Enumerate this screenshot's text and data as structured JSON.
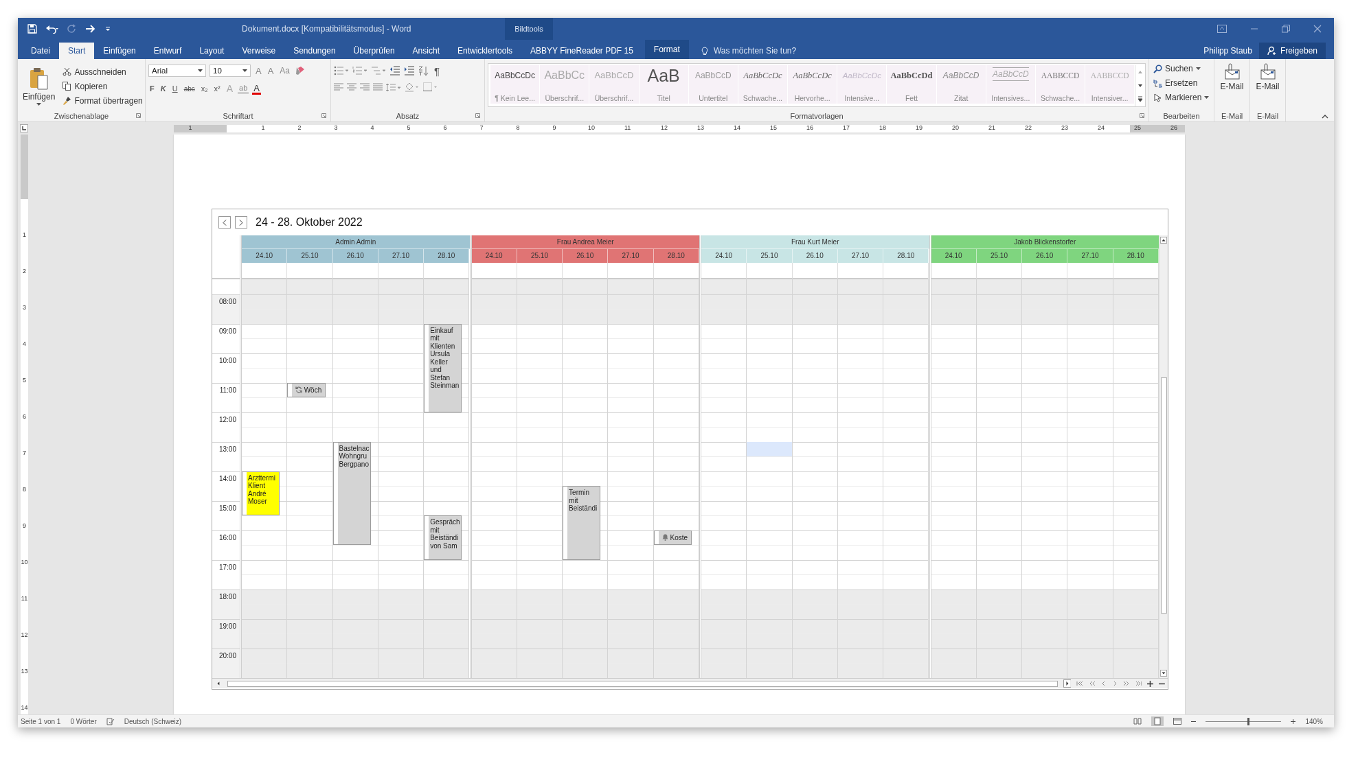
{
  "window": {
    "title": "Dokument.docx [Kompatibilitätsmodus] - Word",
    "context_label": "Bildtools"
  },
  "tabs": [
    {
      "label": "Datei",
      "selected": false,
      "kind": "normal"
    },
    {
      "label": "Start",
      "selected": true,
      "kind": "normal"
    },
    {
      "label": "Einfügen",
      "selected": false,
      "kind": "normal"
    },
    {
      "label": "Entwurf",
      "selected": false,
      "kind": "normal"
    },
    {
      "label": "Layout",
      "selected": false,
      "kind": "normal"
    },
    {
      "label": "Verweise",
      "selected": false,
      "kind": "normal"
    },
    {
      "label": "Sendungen",
      "selected": false,
      "kind": "normal"
    },
    {
      "label": "Überprüfen",
      "selected": false,
      "kind": "normal"
    },
    {
      "label": "Ansicht",
      "selected": false,
      "kind": "normal"
    },
    {
      "label": "Entwicklertools",
      "selected": false,
      "kind": "normal"
    },
    {
      "label": "ABBYY FineReader PDF 15",
      "selected": false,
      "kind": "normal"
    },
    {
      "label": "Format",
      "selected": false,
      "kind": "contextual"
    }
  ],
  "tell_me": {
    "placeholder": "Was möchten Sie tun?"
  },
  "user": "Philipp Staub",
  "share_button": "Freigeben",
  "ribbon": {
    "clipboard": {
      "title": "Zwischenablage",
      "paste": "Einfügen",
      "items": [
        "Ausschneiden",
        "Kopieren",
        "Format übertragen"
      ]
    },
    "font": {
      "title": "Schriftart",
      "font_name": "Arial",
      "font_size": "10",
      "size_tools": [
        {
          "label": "A",
          "kind": "grow"
        },
        {
          "label": "A",
          "kind": "shrink"
        },
        {
          "label": "Aa",
          "kind": "case"
        }
      ],
      "format_tools": [
        {
          "label": "F",
          "kind": "bold"
        },
        {
          "label": "K",
          "kind": "italic"
        },
        {
          "label": "U",
          "kind": "underline"
        },
        {
          "label": "abc",
          "kind": "strike"
        },
        {
          "label": "x₂",
          "kind": "sub"
        },
        {
          "label": "x²",
          "kind": "sup"
        },
        {
          "label": "A",
          "kind": "effects"
        },
        {
          "label": "ab",
          "kind": "highlight"
        },
        {
          "label": "A",
          "kind": "color"
        }
      ]
    },
    "paragraph": {
      "title": "Absatz",
      "pilcrow": "¶"
    },
    "styles": {
      "title": "Formatvorlagen",
      "items": [
        {
          "preview": "AaBbCcDc",
          "name": "¶ Kein Lee...",
          "kind": "normal"
        },
        {
          "preview": "AaBbCc",
          "name": "Überschrif...",
          "kind": "heading"
        },
        {
          "preview": "AaBbCcD",
          "name": "Überschrif...",
          "kind": "heading2"
        },
        {
          "preview": "AaB",
          "name": "Titel",
          "kind": "title"
        },
        {
          "preview": "AaBbCcD",
          "name": "Untertitel",
          "kind": "subtitle"
        },
        {
          "preview": "AaBbCcDc",
          "name": "Schwache...",
          "kind": "italic"
        },
        {
          "preview": "AaBbCcDc",
          "name": "Hervorhe...",
          "kind": "italic"
        },
        {
          "preview": "AaBbCcDc",
          "name": "Intensive...",
          "kind": "faint-italic"
        },
        {
          "preview": "AaBbCcDd",
          "name": "Fett",
          "kind": "bold"
        },
        {
          "preview": "AaBbCcD",
          "name": "Zitat",
          "kind": "quote"
        },
        {
          "preview": "AaBbCcD",
          "name": "Intensives...",
          "kind": "intense-quote"
        },
        {
          "preview": "AABBCCD",
          "name": "Schwache...",
          "kind": "caps"
        },
        {
          "preview": "AABBCCD",
          "name": "Intensiver...",
          "kind": "faint-caps"
        }
      ]
    },
    "editing": {
      "title": "Bearbeiten",
      "items": [
        {
          "label": "Suchen",
          "dropdown": true
        },
        {
          "label": "Ersetzen",
          "dropdown": false
        },
        {
          "label": "Markieren",
          "dropdown": true
        }
      ]
    },
    "mail_groups": [
      {
        "button": "E-Mail",
        "title": "E-Mail"
      },
      {
        "button": "E-Mail",
        "title": "E-Mail"
      }
    ]
  },
  "ruler": {
    "left_marks": [
      "1"
    ],
    "right_marks": [
      "1",
      "2",
      "3",
      "4",
      "5",
      "6",
      "7",
      "8",
      "9",
      "10",
      "11",
      "12",
      "13",
      "14",
      "15",
      "16",
      "17",
      "18",
      "19",
      "20",
      "21",
      "22",
      "23",
      "24",
      "25",
      "26"
    ],
    "vertical_marks": [
      "1",
      "2",
      "3",
      "4",
      "5",
      "6",
      "7",
      "8",
      "9",
      "10",
      "11",
      "12",
      "13",
      "14"
    ]
  },
  "calendar": {
    "title": "24 - 28. Oktober 2022",
    "time_rows": [
      {
        "label": "08:00",
        "working": false
      },
      {
        "label": "09:00",
        "working": true
      },
      {
        "label": "10:00",
        "working": true
      },
      {
        "label": "11:00",
        "working": true
      },
      {
        "label": "12:00",
        "working": true
      },
      {
        "label": "13:00",
        "working": true
      },
      {
        "label": "14:00",
        "working": true
      },
      {
        "label": "15:00",
        "working": true
      },
      {
        "label": "16:00",
        "working": true
      },
      {
        "label": "17:00",
        "working": true
      },
      {
        "label": "18:00",
        "working": false
      },
      {
        "label": "19:00",
        "working": false
      },
      {
        "label": "20:00",
        "working": false
      }
    ],
    "resources": [
      {
        "name": "Admin Admin",
        "color": "#9fc4d2",
        "days": [
          {
            "date": "24.10",
            "timeline": [
              {
                "kind": "free"
              },
              {
                "kind": "free"
              },
              {
                "kind": "free"
              },
              {
                "kind": "free"
              },
              {
                "kind": "free"
              },
              {
                "kind": "free"
              },
              {
                "kind": "free"
              },
              {
                "kind": "free"
              },
              {
                "kind": "free"
              },
              {
                "kind": "free"
              },
              {
                "kind": "free"
              },
              {
                "kind": "free"
              },
              {
                "kind": "free"
              },
              {
                "kind": "start",
                "event": {
                  "text": "Arzttermi Klient André Moser",
                  "color": "#ffff00",
                  "kind": "plain"
                }
              },
              {
                "kind": "busy"
              },
              {
                "kind": "busy"
              }
            ]
          },
          {
            "date": "25.10",
            "timeline": [
              {
                "kind": "free"
              },
              {
                "kind": "free"
              },
              {
                "kind": "free"
              },
              {
                "kind": "free"
              },
              {
                "kind": "free"
              },
              {
                "kind": "free"
              },
              {
                "kind": "free"
              },
              {
                "kind": "start",
                "event": {
                  "text": "Wöch",
                  "color": "#d4d4d4",
                  "kind": "recurring"
                }
              }
            ]
          },
          {
            "date": "26.10",
            "timeline": [
              {
                "kind": "free"
              },
              {
                "kind": "free"
              },
              {
                "kind": "free"
              },
              {
                "kind": "free"
              },
              {
                "kind": "free"
              },
              {
                "kind": "free"
              },
              {
                "kind": "free"
              },
              {
                "kind": "free"
              },
              {
                "kind": "free"
              },
              {
                "kind": "free"
              },
              {
                "kind": "free"
              },
              {
                "kind": "start",
                "event": {
                  "text": "Bastelnac Wohngru Bergpano",
                  "color": "#d4d4d4",
                  "kind": "plain"
                }
              },
              {
                "kind": "busy"
              },
              {
                "kind": "busy"
              },
              {
                "kind": "busy"
              },
              {
                "kind": "busy"
              },
              {
                "kind": "busy"
              },
              {
                "kind": "busy"
              }
            ]
          },
          {
            "date": "27.10"
          },
          {
            "date": "28.10",
            "timeline": [
              {
                "kind": "free"
              },
              {
                "kind": "free"
              },
              {
                "kind": "free"
              },
              {
                "kind": "start",
                "event": {
                  "text": "Einkauf mit Klienten Ursula Keller und Stefan Steinman",
                  "color": "#d4d4d4",
                  "kind": "plain"
                }
              },
              {
                "kind": "busy"
              },
              {
                "kind": "busy"
              },
              {
                "kind": "busy"
              },
              {
                "kind": "busy"
              },
              {
                "kind": "busy"
              },
              {
                "kind": "free"
              },
              {
                "kind": "free"
              },
              {
                "kind": "free"
              },
              {
                "kind": "free"
              },
              {
                "kind": "free"
              },
              {
                "kind": "free"
              },
              {
                "kind": "free"
              },
              {
                "kind": "start",
                "event": {
                  "text": "Gespräch mit Beiständi von Sam",
                  "color": "#d4d4d4",
                  "kind": "plain"
                }
              },
              {
                "kind": "busy"
              },
              {
                "kind": "busy"
              }
            ]
          }
        ]
      },
      {
        "name": "Frau Andrea Meier",
        "color": "#e07474",
        "days": [
          {
            "date": "24.10"
          },
          {
            "date": "25.10"
          },
          {
            "date": "26.10",
            "timeline": [
              {
                "kind": "free"
              },
              {
                "kind": "free"
              },
              {
                "kind": "free"
              },
              {
                "kind": "free"
              },
              {
                "kind": "free"
              },
              {
                "kind": "free"
              },
              {
                "kind": "free"
              },
              {
                "kind": "free"
              },
              {
                "kind": "free"
              },
              {
                "kind": "free"
              },
              {
                "kind": "free"
              },
              {
                "kind": "free"
              },
              {
                "kind": "free"
              },
              {
                "kind": "free"
              },
              {
                "kind": "start",
                "event": {
                  "text": "Termin mit Beiständi",
                  "color": "#d4d4d4",
                  "kind": "plain"
                }
              },
              {
                "kind": "busy"
              },
              {
                "kind": "busy"
              },
              {
                "kind": "busy"
              },
              {
                "kind": "busy"
              }
            ]
          },
          {
            "date": "27.10"
          },
          {
            "date": "28.10",
            "timeline": [
              {
                "kind": "free"
              },
              {
                "kind": "free"
              },
              {
                "kind": "free"
              },
              {
                "kind": "free"
              },
              {
                "kind": "free"
              },
              {
                "kind": "free"
              },
              {
                "kind": "free"
              },
              {
                "kind": "free"
              },
              {
                "kind": "free"
              },
              {
                "kind": "free"
              },
              {
                "kind": "free"
              },
              {
                "kind": "free"
              },
              {
                "kind": "free"
              },
              {
                "kind": "free"
              },
              {
                "kind": "free"
              },
              {
                "kind": "free"
              },
              {
                "kind": "free"
              },
              {
                "kind": "start",
                "event": {
                  "text": "Koste",
                  "color": "#d4d4d4",
                  "kind": "reminder"
                }
              }
            ]
          }
        ]
      },
      {
        "name": "Frau Kurt Meier",
        "color": "#c8e5e5",
        "days": [
          {
            "date": "24.10"
          },
          {
            "date": "25.10",
            "timeline": [
              {
                "kind": "free"
              },
              {
                "kind": "free"
              },
              {
                "kind": "free"
              },
              {
                "kind": "free"
              },
              {
                "kind": "free"
              },
              {
                "kind": "free"
              },
              {
                "kind": "free"
              },
              {
                "kind": "free"
              },
              {
                "kind": "free"
              },
              {
                "kind": "free"
              },
              {
                "kind": "free"
              },
              {
                "kind": "selected"
              }
            ]
          },
          {
            "date": "26.10"
          },
          {
            "date": "27.10"
          },
          {
            "date": "28.10"
          }
        ]
      },
      {
        "name": "Jakob Blickenstorfer",
        "color": "#7fd57f",
        "days": [
          {
            "date": "24.10"
          },
          {
            "date": "25.10"
          },
          {
            "date": "26.10"
          },
          {
            "date": "27.10"
          },
          {
            "date": "28.10"
          }
        ]
      }
    ]
  },
  "status_bar": {
    "page": "Seite 1 von 1",
    "words": "0 Wörter",
    "language": "Deutsch (Schweiz)",
    "zoom": "140%",
    "zoom_slider": {
      "level": 0.56
    }
  }
}
